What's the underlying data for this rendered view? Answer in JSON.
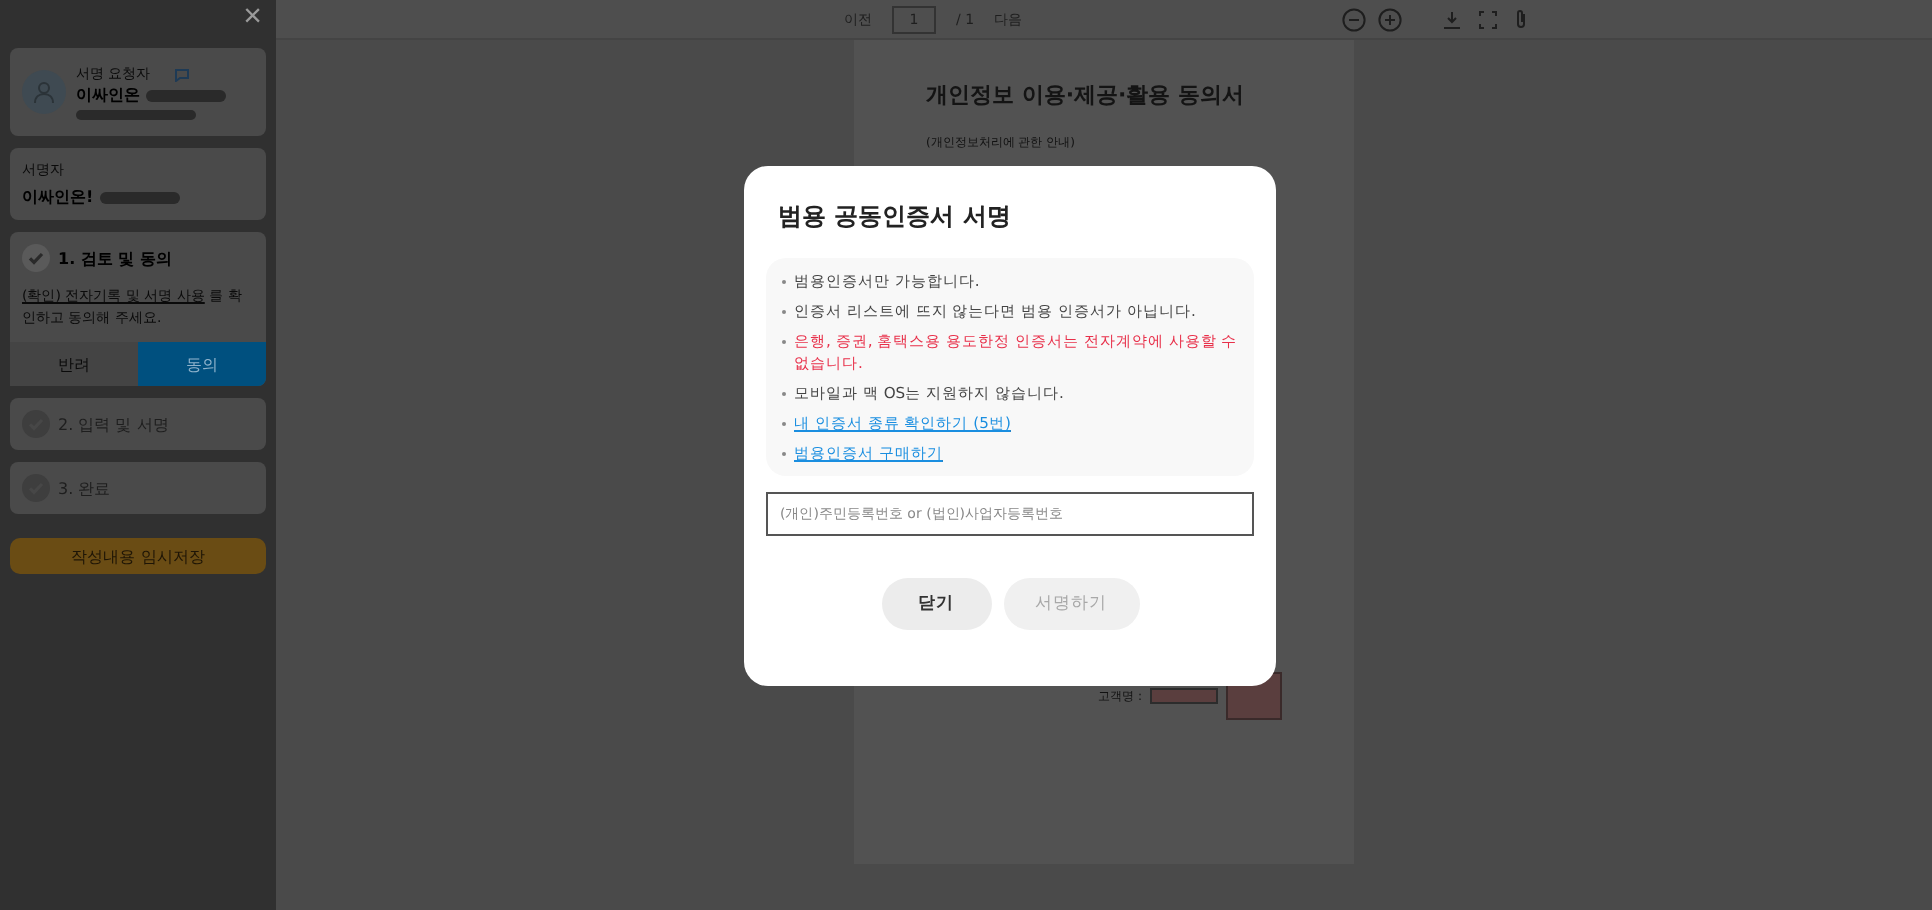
{
  "sidebar": {
    "close": "×",
    "requester": {
      "label": "서명 요청자",
      "name": "이싸인온"
    },
    "signer": {
      "label": "서명자",
      "name": "이싸인온!"
    },
    "steps": [
      {
        "title": "1. 검토 및 동의",
        "done": true,
        "expanded": true,
        "link": "(확인) 전자기록 및 서명 사용",
        "text": " 를 확인하고 동의해 주세요.",
        "choices": [
          {
            "label": "반려",
            "selected": false
          },
          {
            "label": "동의",
            "selected": true
          }
        ]
      },
      {
        "title": "2. 입력 및 서명",
        "done": false,
        "expanded": false
      },
      {
        "title": "3. 완료",
        "done": false,
        "expanded": false
      }
    ],
    "save_button": "작성내용 임시저장"
  },
  "toolbar": {
    "prev": "이전",
    "page": "1",
    "total": "/ 1",
    "next": "다음"
  },
  "document": {
    "title": "개인정보 이용·제공·활용 동의서",
    "subtitle": "(개인정보처리에 관한 안내)",
    "customer_label": "고객명 :"
  },
  "modal": {
    "title": "범용 공동인증서 서명",
    "notes": [
      {
        "kind": "text",
        "text": "범용인증서만 가능합니다."
      },
      {
        "kind": "text",
        "text": "인증서 리스트에 뜨지 않는다면 범용 인증서가 아닙니다."
      },
      {
        "kind": "warning",
        "text": "은행, 증권, 홈택스용 용도한정 인증서는 전자계약에 사용할 수 없습니다."
      },
      {
        "kind": "text",
        "text": "모바일과 맥 OS는 지원하지 않습니다."
      },
      {
        "kind": "link",
        "text": "내 인증서 종류 확인하기 (5번)"
      },
      {
        "kind": "link",
        "text": "범용인증서 구매하기"
      }
    ],
    "input": {
      "placeholder": "(개인)주민등록번호 or (법인)사업자등록번호"
    },
    "buttons": [
      {
        "label": "닫기",
        "disabled": false
      },
      {
        "label": "서명하기",
        "disabled": true
      }
    ]
  }
}
